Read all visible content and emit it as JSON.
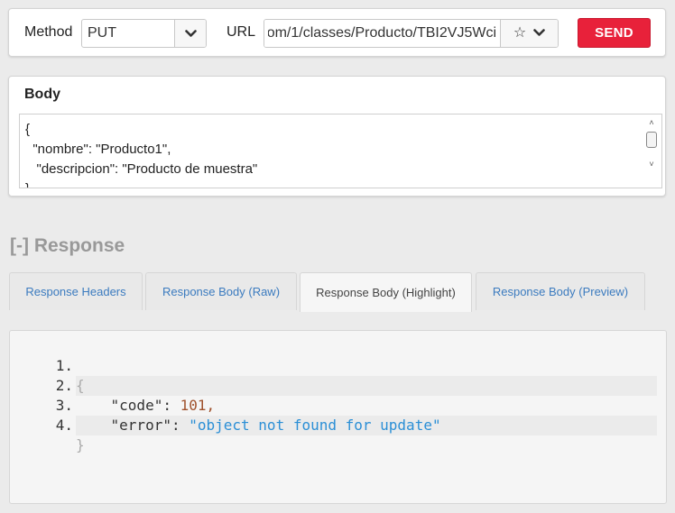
{
  "request": {
    "method_label": "Method",
    "method_value": "PUT",
    "url_label": "URL",
    "url_value": "om/1/classes/Producto/TBI2VJ5Wci",
    "send_label": "SEND",
    "star_glyph": "☆"
  },
  "body": {
    "title": "Body",
    "text": "{\n  \"nombre\": \"Producto1\",\n   \"descripcion\": \"Producto de muestra\"\n}"
  },
  "response": {
    "heading": "[-] Response",
    "tabs": [
      {
        "label": "Response Headers",
        "active": false
      },
      {
        "label": "Response Body (Raw)",
        "active": false
      },
      {
        "label": "Response Body (Highlight)",
        "active": true
      },
      {
        "label": "Response Body (Preview)",
        "active": false
      }
    ],
    "lines": [
      {
        "num": "1.",
        "open": "{"
      },
      {
        "num": "2.",
        "key": "\"code\"",
        "colon": ": ",
        "value": "101",
        "comma": ","
      },
      {
        "num": "3.",
        "key": "\"error\"",
        "colon": ": ",
        "value": "\"object not found for update\""
      },
      {
        "num": "4.",
        "close": "}"
      }
    ]
  },
  "colors": {
    "send_button": "#e8213a",
    "link_tab": "#3b7bbf",
    "string_token": "#2b8fd6",
    "number_token": "#a0522d",
    "heading_gray": "#999999"
  }
}
